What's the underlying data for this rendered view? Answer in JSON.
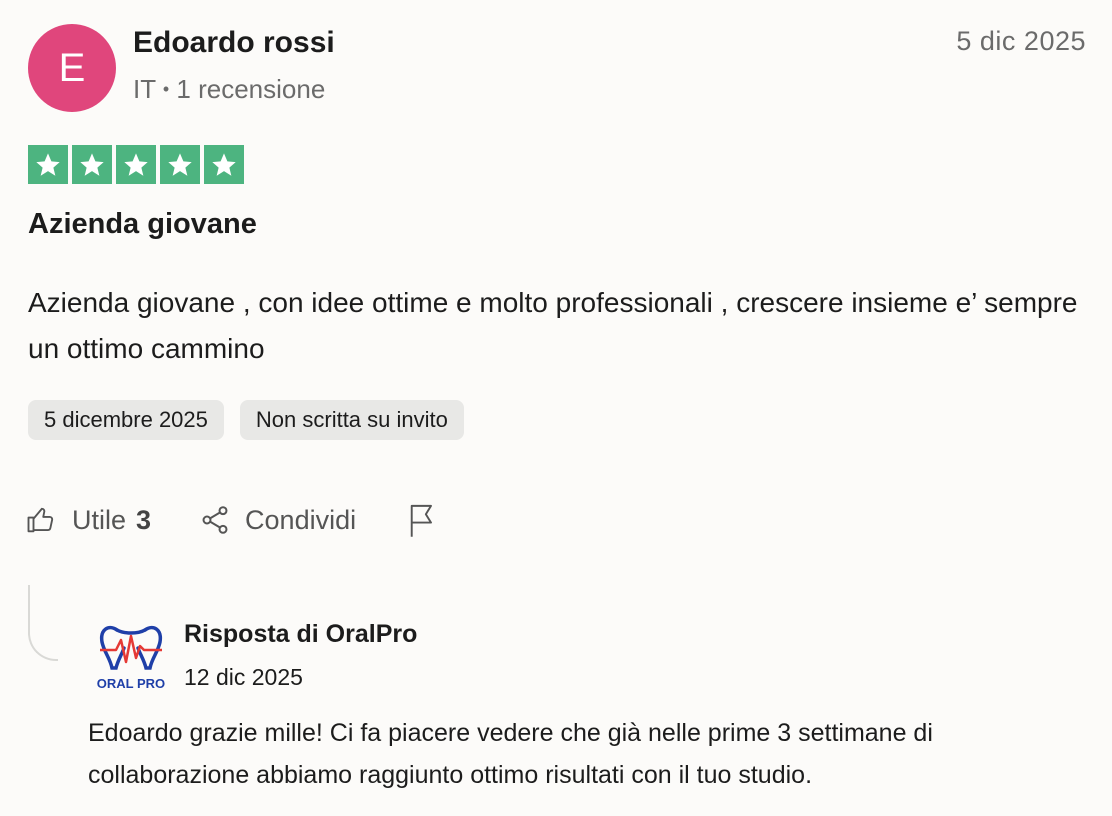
{
  "review": {
    "avatar_initial": "E",
    "avatar_color": "#e0467c",
    "author": "Edoardo rossi",
    "country": "IT",
    "separator": "•",
    "review_count": "1 recensione",
    "date_short": "5 dic 2025",
    "rating": 5,
    "rating_max": 5,
    "star_color": "#4db480",
    "title": "Azienda giovane",
    "text": "Azienda giovane , con idee ottime e molto professionali , crescere insieme e’ sempre un ottimo cammino",
    "tags": [
      "5 dicembre 2025",
      "Non scritta su invito"
    ],
    "actions": {
      "useful_icon": "thumbs-up-icon",
      "useful_label": "Utile",
      "useful_count": "3",
      "share_icon": "share-icon",
      "share_label": "Condividi",
      "report_icon": "flag-icon"
    }
  },
  "reply": {
    "logo_text": "ORAL PRO",
    "author": "Risposta di OralPro",
    "date": "12 dic 2025",
    "text": "Edoardo grazie mille! Ci fa piacere vedere che già nelle prime 3 settimane di collaborazione abbiamo raggiunto ottimo risultati con il tuo studio."
  }
}
